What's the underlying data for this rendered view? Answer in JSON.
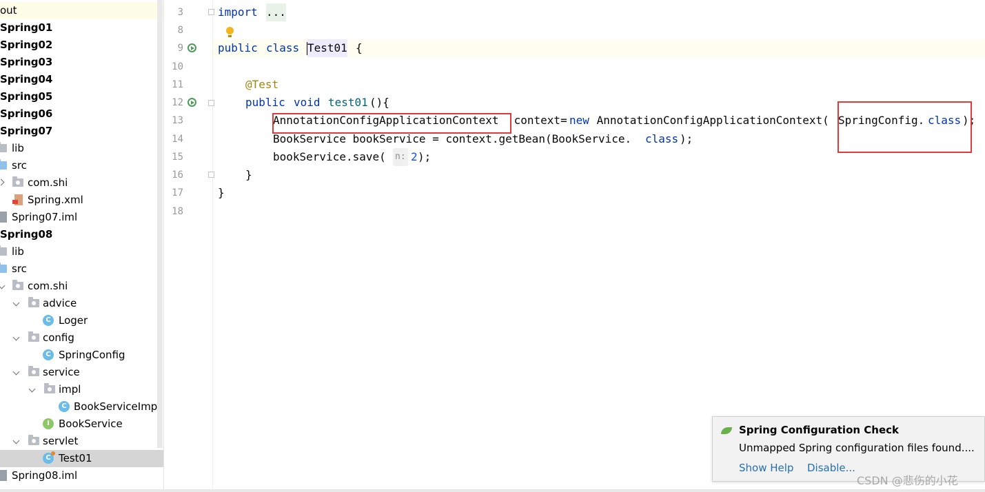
{
  "project_tree": {
    "items": [
      {
        "label": "out",
        "bold": false
      },
      {
        "label": "Spring01",
        "bold": true
      },
      {
        "label": "Spring02",
        "bold": true
      },
      {
        "label": "Spring03",
        "bold": true
      },
      {
        "label": "Spring04",
        "bold": true
      },
      {
        "label": "Spring05",
        "bold": true
      },
      {
        "label": "Spring06",
        "bold": true
      },
      {
        "label": "Spring07",
        "bold": true
      },
      {
        "label": "lib"
      },
      {
        "label": "src"
      },
      {
        "label": "com.shi"
      },
      {
        "label": "Spring.xml"
      },
      {
        "label": "Spring07.iml"
      },
      {
        "label": "Spring08",
        "bold": true
      },
      {
        "label": "lib"
      },
      {
        "label": "src"
      },
      {
        "label": "com.shi"
      },
      {
        "label": "advice"
      },
      {
        "label": "Loger"
      },
      {
        "label": "config"
      },
      {
        "label": "SpringConfig"
      },
      {
        "label": "service"
      },
      {
        "label": "impl"
      },
      {
        "label": "BookServiceImpl"
      },
      {
        "label": "BookService"
      },
      {
        "label": "servlet"
      },
      {
        "label": "Test01"
      },
      {
        "label": "Spring08.iml"
      }
    ],
    "icon_glyphs": {
      "class": "C",
      "interface": "I"
    }
  },
  "editor": {
    "line_numbers": [
      "3",
      "8",
      "9",
      "10",
      "11",
      "12",
      "13",
      "14",
      "15",
      "16",
      "17",
      "18"
    ],
    "lines": {
      "l3": {
        "kw": "import",
        "folded": "..."
      },
      "l9": {
        "kw_public": "public",
        "kw_class": "class",
        "class_name": "Test01",
        "brace": "{"
      },
      "l11": {
        "annotation": "@Test"
      },
      "l12": {
        "kw_public": "public",
        "kw_void": "void",
        "method": "test01",
        "rest": "(){"
      },
      "l13": {
        "type": "AnnotationConfigApplicationContext",
        "var": " context=",
        "kw_new": "new",
        "ctor": " AnnotationConfigApplicationContext(",
        "arg": "SpringConfig.",
        "kw_class": "class",
        "end": ");"
      },
      "l14": {
        "pre": "BookService bookService = context.getBean(BookService.",
        "kw_class": "class",
        "end": ");"
      },
      "l15": {
        "pre": "bookService.save(",
        "hint": "n:",
        "num": "2",
        "end": ");"
      },
      "l16": {
        "text": "}"
      },
      "l17": {
        "text": "}"
      }
    }
  },
  "notification": {
    "title": "Spring Configuration Check",
    "body": "Unmapped Spring configuration files found....",
    "show_help": "Show Help",
    "disable": "Disable..."
  },
  "watermark": "CSDN @悲伤的小花",
  "colors": {
    "keyword": "#0033b3",
    "annotation": "#9e880d",
    "method": "#00627a",
    "number": "#1750eb",
    "link": "#2470b3",
    "annotation_box": "#e5383b"
  }
}
